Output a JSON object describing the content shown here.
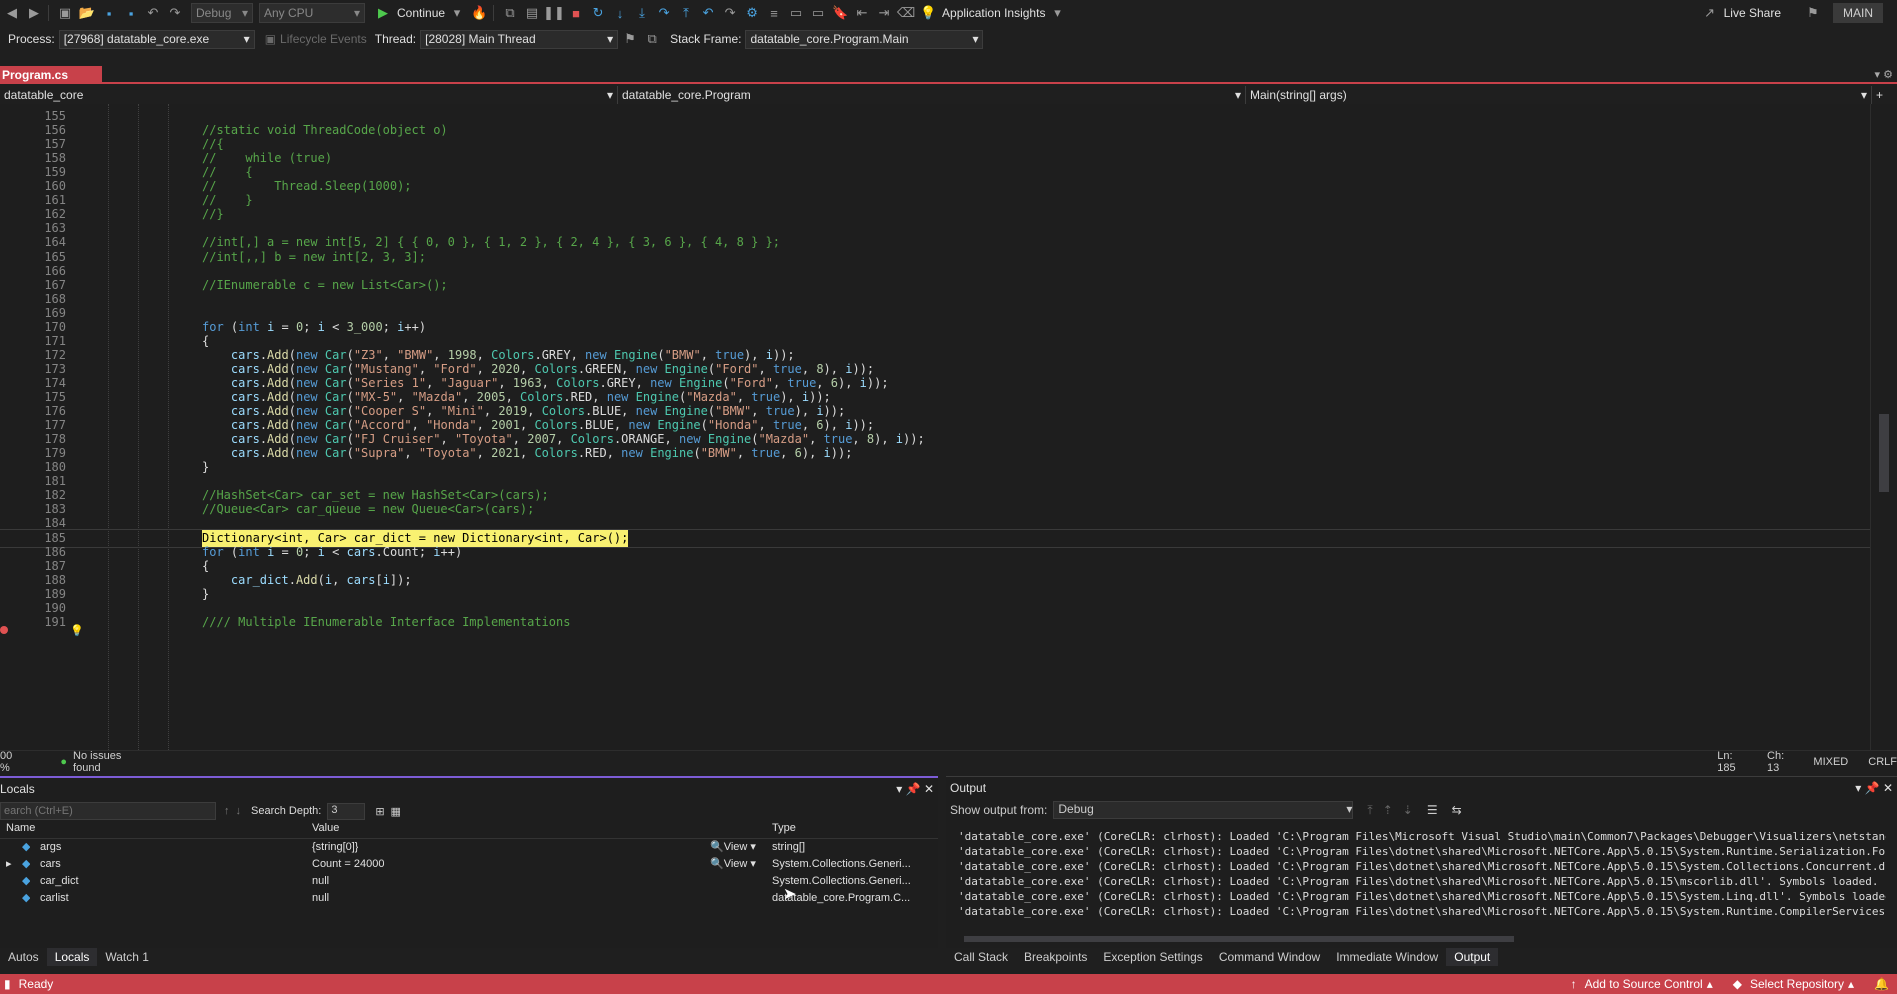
{
  "toolbar": {
    "config_combo": "Debug",
    "platform_combo": "Any CPU",
    "continue_label": "Continue",
    "app_insights_label": "Application Insights",
    "live_share_label": "Live Share",
    "branch_badge": "MAIN"
  },
  "debug_location": {
    "process_label": "Process:",
    "process_value": "[27968] datatable_core.exe",
    "lifecycle_label": "Lifecycle Events",
    "thread_label": "Thread:",
    "thread_value": "[28028] Main Thread",
    "stack_frame_label": "Stack Frame:",
    "stack_frame_value": "datatable_core.Program.Main"
  },
  "tabs": {
    "active_tab": "Program.cs"
  },
  "navbar": {
    "project": "datatable_core",
    "class": "datatable_core.Program",
    "member": "Main(string[] args)"
  },
  "editor": {
    "lines": [
      {
        "n": "155",
        "text": ""
      },
      {
        "n": "156",
        "text": "//static void ThreadCode(object o)"
      },
      {
        "n": "157",
        "text": "//{"
      },
      {
        "n": "158",
        "text": "//    while (true)"
      },
      {
        "n": "159",
        "text": "//    {"
      },
      {
        "n": "160",
        "text": "//        Thread.Sleep(1000);"
      },
      {
        "n": "161",
        "text": "//    }"
      },
      {
        "n": "162",
        "text": "//}"
      },
      {
        "n": "163",
        "text": ""
      },
      {
        "n": "164",
        "text": "//int[,] a = new int[5, 2] { { 0, 0 }, { 1, 2 }, { 2, 4 }, { 3, 6 }, { 4, 8 } };"
      },
      {
        "n": "165",
        "text": "//int[,,] b = new int[2, 3, 3];"
      },
      {
        "n": "166",
        "text": ""
      },
      {
        "n": "167",
        "text": "//IEnumerable c = new List<Car>();"
      },
      {
        "n": "168",
        "text": ""
      },
      {
        "n": "169",
        "text": ""
      },
      {
        "n": "170",
        "text": "for (int i = 0; i < 3_000; i++)"
      },
      {
        "n": "171",
        "text": "{"
      },
      {
        "n": "172",
        "text": "    cars.Add(new Car(\"Z3\", \"BMW\", 1998, Colors.GREY, new Engine(\"BMW\", true), i));"
      },
      {
        "n": "173",
        "text": "    cars.Add(new Car(\"Mustang\", \"Ford\", 2020, Colors.GREEN, new Engine(\"Ford\", true, 8), i));"
      },
      {
        "n": "174",
        "text": "    cars.Add(new Car(\"Series 1\", \"Jaguar\", 1963, Colors.GREY, new Engine(\"Ford\", true, 6), i));"
      },
      {
        "n": "175",
        "text": "    cars.Add(new Car(\"MX-5\", \"Mazda\", 2005, Colors.RED, new Engine(\"Mazda\", true), i));"
      },
      {
        "n": "176",
        "text": "    cars.Add(new Car(\"Cooper S\", \"Mini\", 2019, Colors.BLUE, new Engine(\"BMW\", true), i));"
      },
      {
        "n": "177",
        "text": "    cars.Add(new Car(\"Accord\", \"Honda\", 2001, Colors.BLUE, new Engine(\"Honda\", true, 6), i));"
      },
      {
        "n": "178",
        "text": "    cars.Add(new Car(\"FJ Cruiser\", \"Toyota\", 2007, Colors.ORANGE, new Engine(\"Mazda\", true, 8), i));"
      },
      {
        "n": "179",
        "text": "    cars.Add(new Car(\"Supra\", \"Toyota\", 2021, Colors.RED, new Engine(\"BMW\", true, 6), i));"
      },
      {
        "n": "180",
        "text": "}"
      },
      {
        "n": "181",
        "text": ""
      },
      {
        "n": "182",
        "text": "//HashSet<Car> car_set = new HashSet<Car>(cars);"
      },
      {
        "n": "183",
        "text": "//Queue<Car> car_queue = new Queue<Car>(cars);"
      },
      {
        "n": "184",
        "text": ""
      },
      {
        "n": "185",
        "text": "Dictionary<int, Car> car_dict = new Dictionary<int, Car>();"
      },
      {
        "n": "186",
        "text": "for (int i = 0; i < cars.Count; i++)"
      },
      {
        "n": "187",
        "text": "{"
      },
      {
        "n": "188",
        "text": "    car_dict.Add(i, cars[i]);"
      },
      {
        "n": "189",
        "text": "}"
      },
      {
        "n": "190",
        "text": ""
      },
      {
        "n": "191",
        "text": "//// Multiple IEnumerable Interface Implementations"
      }
    ]
  },
  "editor_status": {
    "zoom": "00 %",
    "issues": "No issues found",
    "line": "Ln: 185",
    "col": "Ch: 13",
    "encoding": "MIXED",
    "eol": "CRLF"
  },
  "locals": {
    "title": "Locals",
    "search_placeholder": "earch (Ctrl+E)",
    "search_depth_label": "Search Depth:",
    "search_depth_value": "3",
    "columns": {
      "name": "Name",
      "value": "Value",
      "type": "Type"
    },
    "rows": [
      {
        "name": "args",
        "value": "{string[0]}",
        "view": "View",
        "type": "string[]"
      },
      {
        "name": "cars",
        "value": "Count = 24000",
        "view": "View",
        "type": "System.Collections.Generi..."
      },
      {
        "name": "car_dict",
        "value": "null",
        "view": "",
        "type": "System.Collections.Generi..."
      },
      {
        "name": "carlist",
        "value": "null",
        "view": "",
        "type": "datatable_core.Program.C..."
      }
    ]
  },
  "output": {
    "title": "Output",
    "show_from_label": "Show output from:",
    "show_from_value": "Debug",
    "lines": [
      "'datatable_core.exe' (CoreCLR: clrhost): Loaded 'C:\\Program Files\\Microsoft Visual Studio\\main\\Common7\\Packages\\Debugger\\Visualizers\\netstanda",
      "'datatable_core.exe' (CoreCLR: clrhost): Loaded 'C:\\Program Files\\dotnet\\shared\\Microsoft.NETCore.App\\5.0.15\\System.Runtime.Serialization.Form",
      "'datatable_core.exe' (CoreCLR: clrhost): Loaded 'C:\\Program Files\\dotnet\\shared\\Microsoft.NETCore.App\\5.0.15\\System.Collections.Concurrent.dll",
      "'datatable_core.exe' (CoreCLR: clrhost): Loaded 'C:\\Program Files\\dotnet\\shared\\Microsoft.NETCore.App\\5.0.15\\mscorlib.dll'. Symbols loaded.",
      "'datatable_core.exe' (CoreCLR: clrhost): Loaded 'C:\\Program Files\\dotnet\\shared\\Microsoft.NETCore.App\\5.0.15\\System.Linq.dll'. Symbols loaded.",
      "'datatable_core.exe' (CoreCLR: clrhost): Loaded 'C:\\Program Files\\dotnet\\shared\\Microsoft.NETCore.App\\5.0.15\\System.Runtime.CompilerServices.U"
    ]
  },
  "bottom_tabs_left": [
    "Autos",
    "Locals",
    "Watch 1"
  ],
  "bottom_tabs_right": [
    "Call Stack",
    "Breakpoints",
    "Exception Settings",
    "Command Window",
    "Immediate Window",
    "Output"
  ],
  "statusbar": {
    "ready": "Ready",
    "source_control": "Add to Source Control",
    "repository": "Select Repository"
  },
  "colors": {
    "accent_red": "#c8414a",
    "locals_accent": "#7c5cd6",
    "current_line": "#f9f171"
  }
}
